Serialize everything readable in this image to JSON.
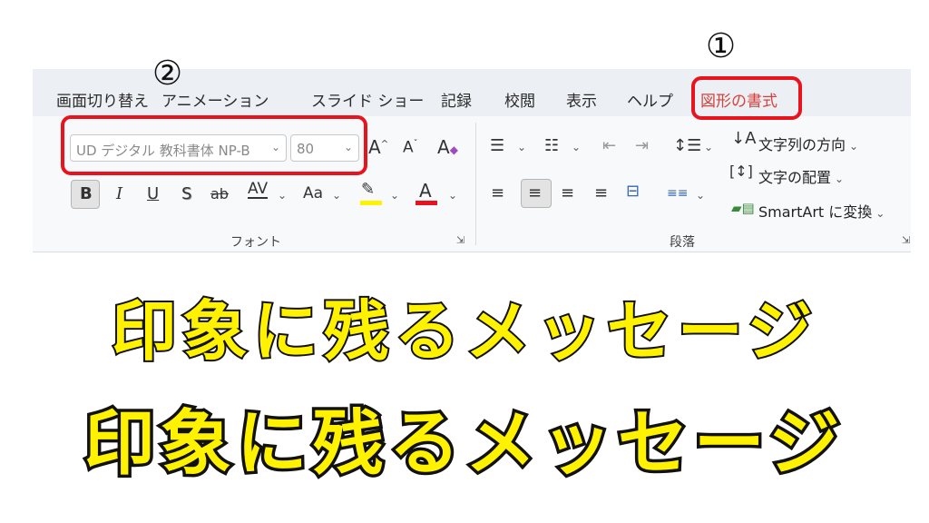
{
  "markers": {
    "one": "①",
    "two": "②"
  },
  "tabs": [
    {
      "label": "画面切り替え"
    },
    {
      "label": "アニメーション"
    },
    {
      "label": "スライド ショー"
    },
    {
      "label": "記録"
    },
    {
      "label": "校閲"
    },
    {
      "label": "表示"
    },
    {
      "label": "ヘルプ"
    },
    {
      "label": "図形の書式"
    }
  ],
  "font_group": {
    "font_name": "UD デジタル 教科書体 NP-B",
    "font_size": "80",
    "label": "フォント",
    "buttons": {
      "grow": "A",
      "shrink": "A",
      "bold": "B",
      "italic": "I",
      "underline": "U",
      "shadow": "S",
      "strike": "ab",
      "spacing": "AV",
      "case": "Aa",
      "font_color": "A"
    }
  },
  "paragraph_group": {
    "label": "段落",
    "text_direction": "文字列の方向",
    "align_text": "文字の配置",
    "smartart": "SmartArt に変換"
  },
  "colors": {
    "accent": "#d5433e",
    "highlight_box": "#e8131d",
    "big_text": "#fff200",
    "font_color_bar": "#e8131d",
    "highlight_bar": "#fff200"
  },
  "canvas": {
    "line1": "印象に残るメッセージ",
    "line2": "印象に残るメッセージ"
  }
}
